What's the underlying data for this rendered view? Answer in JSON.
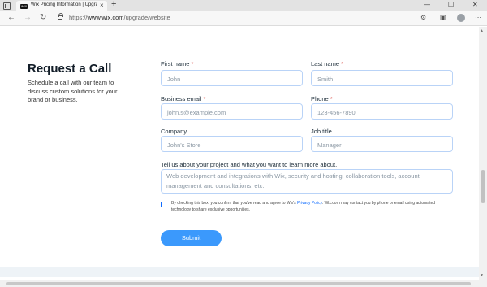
{
  "browser": {
    "tab_title": "Wix Pricing Information | Upgrade...",
    "tab_favicon": "WIX",
    "tab_close": "×",
    "new_tab": "+",
    "window_controls": {
      "minimize": "—",
      "maximize": "☐",
      "close": "✕"
    },
    "url_scheme": "https://",
    "url_host": "www.wix.com",
    "url_path": "/upgrade/website"
  },
  "form": {
    "heading": "Request a Call",
    "description": "Schedule a call with our team to discuss custom solutions for your brand or business.",
    "required_marker": "*",
    "first_name": {
      "label": "First name",
      "placeholder": "John"
    },
    "last_name": {
      "label": "Last name",
      "placeholder": "Smith"
    },
    "business_email": {
      "label": "Business email",
      "placeholder": "john.s@example.com"
    },
    "phone": {
      "label": "Phone",
      "placeholder": "123-456-7890"
    },
    "company": {
      "label": "Company",
      "placeholder": "John's Store"
    },
    "job_title": {
      "label": "Job title",
      "placeholder": "Manager"
    },
    "project": {
      "label": "Tell us about your project and what you want to learn more about.",
      "placeholder": "Web development and integrations with Wix, security and hosting, collaboration tools, account management and consultations, etc."
    },
    "consent": {
      "text_before": "By checking this box, you confirm that you've read and agree to Wix's ",
      "link": "Privacy Policy",
      "text_after": ". Wix.com may contact you by phone or email using automated technology to share exclusive opportunities."
    },
    "submit_label": "Submit"
  },
  "colors": {
    "accent": "#116dff",
    "button": "#3b99fc",
    "field_border": "#b9d3f7",
    "required": "#d6453d"
  }
}
